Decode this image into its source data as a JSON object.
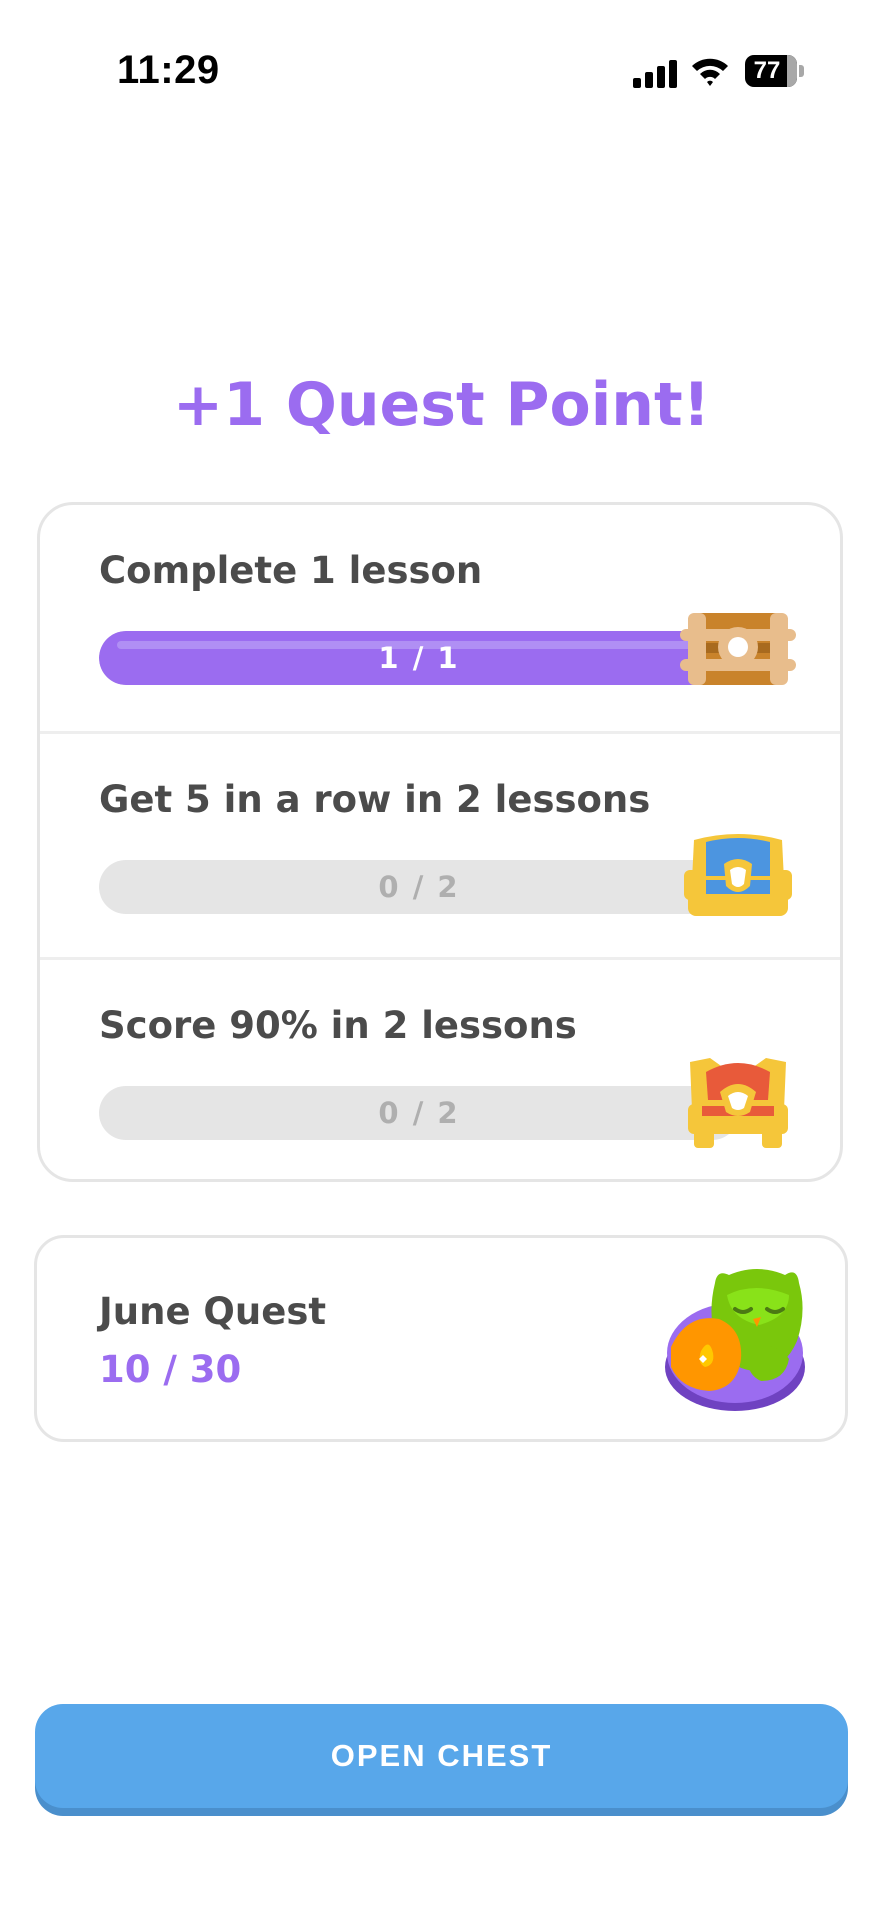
{
  "status_bar": {
    "time": "11:29",
    "battery": "77"
  },
  "headline": "+1 Quest Point!",
  "quests": [
    {
      "title": "Complete 1 lesson",
      "progress_text": "1 / 1",
      "progress": 1.0,
      "chest_icon": "bronze-chest-open-icon"
    },
    {
      "title": "Get 5 in a row in 2 lessons",
      "progress_text": "0 / 2",
      "progress": 0.0,
      "chest_icon": "blue-chest-icon"
    },
    {
      "title": "Score 90% in 2 lessons",
      "progress_text": "0 / 2",
      "progress": 0.0,
      "chest_icon": "red-gold-chest-icon"
    }
  ],
  "monthly": {
    "title": "June Quest",
    "progress_text": "10  / 30",
    "badge_icon": "sleeping-owl-badge-icon"
  },
  "cta": {
    "label": "OPEN CHEST"
  },
  "colors": {
    "accent": "#9b6cf0",
    "button": "#58a7ea",
    "track": "#e5e5e5"
  }
}
